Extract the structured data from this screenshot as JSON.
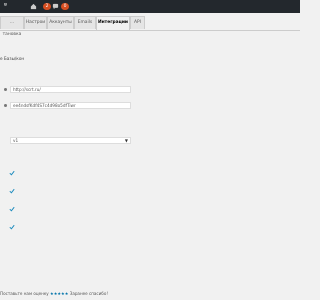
{
  "adminbar": {
    "site_label": "ɐ",
    "badge_updates": "2",
    "badge_comments": "0"
  },
  "tabs": [
    {
      "label": "…тановка",
      "active": false
    },
    {
      "label": "Настрои",
      "active": false
    },
    {
      "label": "Аккаунты",
      "active": false
    },
    {
      "label": "Emails",
      "active": false
    },
    {
      "label": "Интеграции",
      "active": true
    },
    {
      "label": "API",
      "active": false
    }
  ],
  "section": {
    "title": "e Базы/кон"
  },
  "fields": {
    "url_value": "http://scrt.ru/",
    "key_value": "ee4ndsfKdf4S7c4d98o5dfTiwr"
  },
  "select": {
    "value": "v1"
  },
  "checkboxes": [
    {
      "checked": true
    },
    {
      "checked": true
    },
    {
      "checked": true
    },
    {
      "checked": true
    }
  ],
  "footer": {
    "prefix": "Поставьте нам оценку",
    "stars": "★★★★★",
    "suffix": "Заранее спасибо!"
  },
  "colors": {
    "adminbar_bg": "#23282d",
    "badge": "#d54e21",
    "link": "#0073aa"
  }
}
